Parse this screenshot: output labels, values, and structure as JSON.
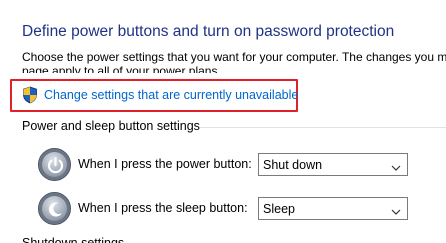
{
  "header": {
    "title": "Define power buttons and turn on password protection",
    "description_line1": "Choose the power settings that you want for your computer. The changes you m",
    "description_line2": "page apply to all of your power plans."
  },
  "change_settings": {
    "label": "Change settings that are currently unavailable",
    "icon": "uac-shield-icon",
    "highlight_color": "#e0202a"
  },
  "section": {
    "title": "Power and sleep button settings"
  },
  "settings": [
    {
      "label": "When I press the power button:",
      "value": "Shut down",
      "icon": "power-button-icon"
    },
    {
      "label": "When I press the sleep button:",
      "value": "Sleep",
      "icon": "sleep-button-icon"
    }
  ],
  "cutoff_text": "Shutdown settings",
  "colors": {
    "title": "#1e3287",
    "link": "#0066cc"
  }
}
